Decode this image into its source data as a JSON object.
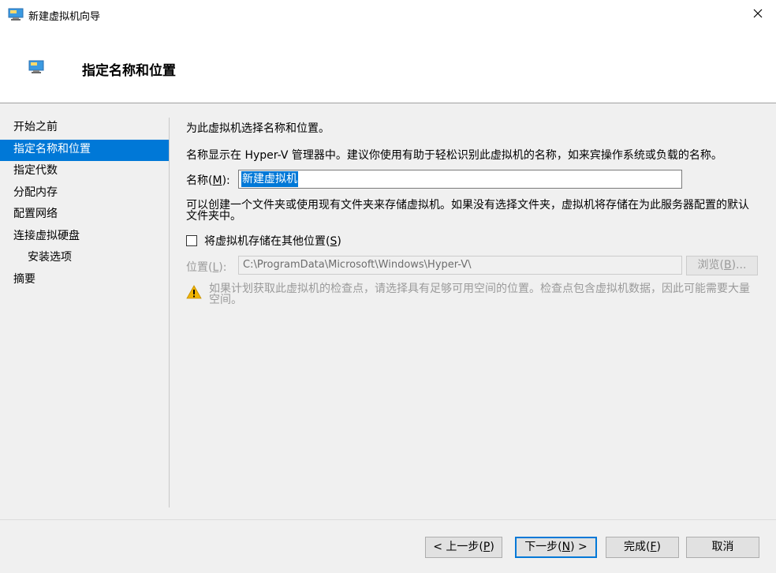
{
  "window": {
    "title": "新建虚拟机向导"
  },
  "header": {
    "heading": "指定名称和位置"
  },
  "nav": {
    "items": [
      {
        "label": "开始之前"
      },
      {
        "label": "指定名称和位置"
      },
      {
        "label": "指定代数"
      },
      {
        "label": "分配内存"
      },
      {
        "label": "配置网络"
      },
      {
        "label": "连接虚拟硬盘"
      },
      {
        "label": "安装选项"
      },
      {
        "label": "摘要"
      }
    ]
  },
  "content": {
    "intro": "为此虚拟机选择名称和位置。",
    "name_hint": "名称显示在 Hyper-V 管理器中。建议你使用有助于轻松识别此虚拟机的名称，如来宾操作系统或负载的名称。",
    "name_label_pre": "名称(",
    "name_label_key": "M",
    "name_label_post": "):",
    "name_value": "新建虚拟机",
    "folder_hint": "可以创建一个文件夹或使用现有文件夹来存储虚拟机。如果没有选择文件夹，虚拟机将存储在为此服务器配置的默认文件夹中。",
    "store_checkbox_pre": "将虚拟机存储在其他位置(",
    "store_checkbox_key": "S",
    "store_checkbox_post": ")",
    "location_label_pre": "位置(",
    "location_label_key": "L",
    "location_label_post": "):",
    "location_value": "C:\\ProgramData\\Microsoft\\Windows\\Hyper-V\\",
    "browse_pre": "浏览(",
    "browse_key": "B",
    "browse_post": ")...",
    "warning": "如果计划获取此虚拟机的检查点，请选择具有足够可用空间的位置。检查点包含虚拟机数据，因此可能需要大量空间。"
  },
  "footer": {
    "prev_pre": "< 上一步(",
    "prev_key": "P",
    "prev_post": ")",
    "next_pre": "下一步(",
    "next_key": "N",
    "next_post": ") >",
    "finish_pre": "完成(",
    "finish_key": "F",
    "finish_post": ")",
    "cancel": "取消"
  },
  "colors": {
    "accent": "#0078d7",
    "warning": "#f0b400"
  }
}
